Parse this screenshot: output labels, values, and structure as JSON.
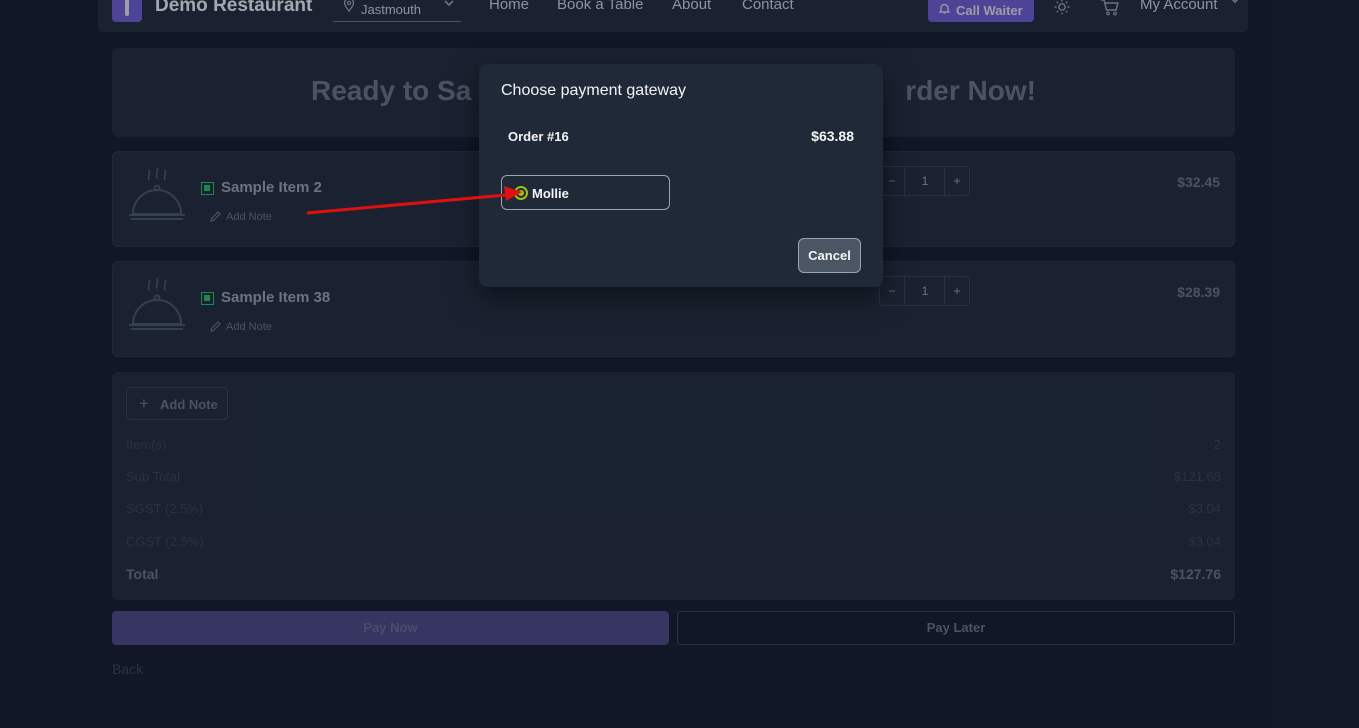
{
  "navbar": {
    "brand": "Demo Restaurant",
    "location": "Jastmouth",
    "links": [
      "Home",
      "Book a Table",
      "About",
      "Contact"
    ],
    "call_waiter": "Call Waiter",
    "account": "My Account"
  },
  "hero": {
    "title_left": "Ready to Sa",
    "title_right": "rder Now!"
  },
  "items": [
    {
      "name": "Sample Item 2",
      "add_note": "Add Note",
      "qty": "1",
      "price": "$32.45"
    },
    {
      "name": "Sample Item 38",
      "add_note": "Add Note",
      "qty": "1",
      "price": "$28.39"
    }
  ],
  "summary": {
    "add_note": "Add Note",
    "rows": [
      {
        "label": "Item(s)",
        "value": "2"
      },
      {
        "label": "Sub Total",
        "value": "$121.68"
      },
      {
        "label": "SGST (2.5%)",
        "value": "$3.04"
      },
      {
        "label": "CGST (2.5%)",
        "value": "$3.04"
      }
    ],
    "total_label": "Total",
    "total_value": "$127.76"
  },
  "actions": {
    "pay_now": "Pay Now",
    "pay_later": "Pay Later",
    "back": "Back"
  },
  "modal": {
    "title": "Choose payment gateway",
    "order_label": "Order #16",
    "order_amount": "$63.88",
    "gateway_option": "Mollie",
    "cancel": "Cancel"
  },
  "colors": {
    "accent": "#6d5dd3",
    "veg": "#22c55e",
    "radio_selected": "#a3c010",
    "annotation_arrow": "#e01010"
  }
}
